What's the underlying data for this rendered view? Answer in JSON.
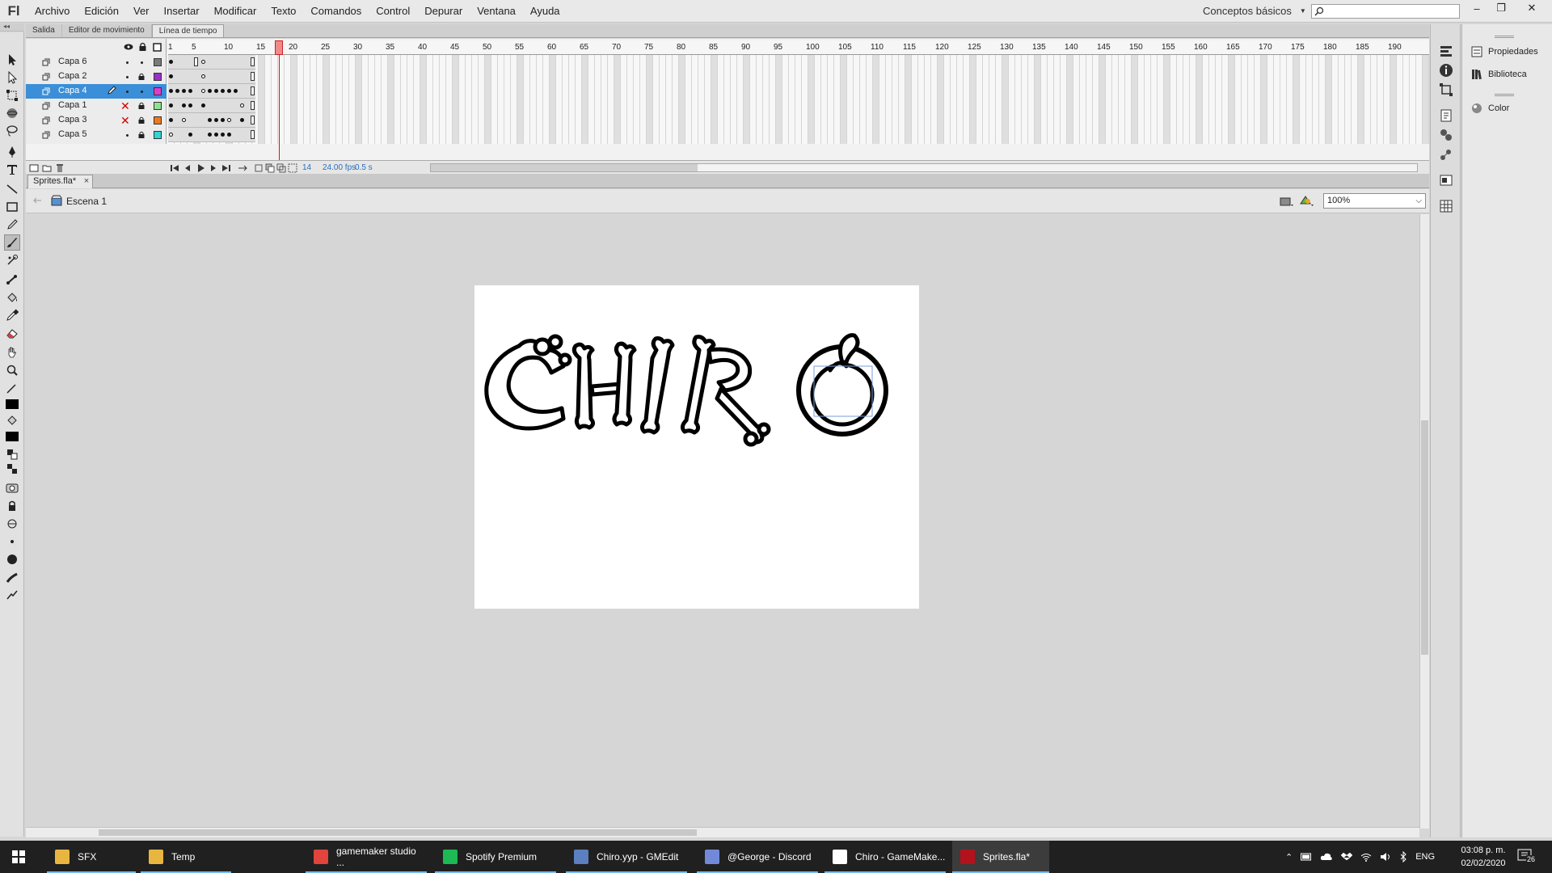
{
  "app": {
    "logo": "Fl"
  },
  "menu": [
    "Archivo",
    "Edición",
    "Ver",
    "Insertar",
    "Modificar",
    "Texto",
    "Comandos",
    "Control",
    "Depurar",
    "Ventana",
    "Ayuda"
  ],
  "workspace": {
    "label": "Conceptos básicos"
  },
  "search": {
    "placeholder": ""
  },
  "window_controls": {
    "minimize": "–",
    "restore": "❐",
    "close": "✕"
  },
  "panel_tabs": [
    {
      "label": "Salida",
      "active": false
    },
    {
      "label": "Editor de movimiento",
      "active": false
    },
    {
      "label": "Línea de tiempo",
      "active": true
    }
  ],
  "timeline": {
    "ruler": [
      "1",
      "5",
      "10",
      "15",
      "20",
      "25",
      "30",
      "35",
      "40",
      "45",
      "50",
      "55",
      "60",
      "65",
      "70",
      "75",
      "80",
      "85",
      "90",
      "95",
      "100",
      "105",
      "110",
      "115",
      "120",
      "125",
      "130",
      "135",
      "140",
      "145",
      "150",
      "155",
      "160",
      "165",
      "170",
      "175",
      "180",
      "185",
      "190"
    ],
    "layers": [
      {
        "name": "Capa 6",
        "color": "#7a7a7a",
        "selected": false,
        "hidden": false,
        "locked": false
      },
      {
        "name": "Capa 2",
        "color": "#9b30c8",
        "selected": false,
        "hidden": false,
        "locked": true
      },
      {
        "name": "Capa 4",
        "color": "#e03ad6",
        "selected": true,
        "hidden": false,
        "locked": false
      },
      {
        "name": "Capa 1",
        "color": "#8fe28f",
        "selected": false,
        "hidden": true,
        "locked": true
      },
      {
        "name": "Capa 3",
        "color": "#f07a1a",
        "selected": false,
        "hidden": true,
        "locked": true
      },
      {
        "name": "Capa 5",
        "color": "#33d4d4",
        "selected": false,
        "hidden": false,
        "locked": true
      }
    ],
    "current_frame": "14",
    "fps": "24.00 fps",
    "time": "0.5 s",
    "playhead_frame": "15"
  },
  "document": {
    "tab": "Sprites.fla*",
    "close": "×",
    "scene": "Escena 1",
    "zoom": "100%"
  },
  "right_panel": {
    "items": [
      "Propiedades",
      "Biblioteca",
      "Color"
    ]
  },
  "taskbar": {
    "items": [
      {
        "label": "SFX",
        "icon": "folder-icon",
        "color": "#e8b640"
      },
      {
        "label": "Temp",
        "icon": "folder-icon",
        "color": "#e8b640"
      },
      {
        "label": "gamemaker studio ...",
        "icon": "chrome-icon",
        "color": "#e0443b"
      },
      {
        "label": "Spotify Premium",
        "icon": "spotify-icon",
        "color": "#1db954"
      },
      {
        "label": "Chiro.yyp - GMEdit",
        "icon": "gmedit-icon",
        "color": "#5b7fbf"
      },
      {
        "label": "@George - Discord",
        "icon": "discord-icon",
        "color": "#7289da"
      },
      {
        "label": "Chiro - GameMake...",
        "icon": "gamemaker-icon",
        "color": "#ffffff"
      },
      {
        "label": "Sprites.fla*",
        "icon": "flash-icon",
        "color": "#b3121c"
      }
    ],
    "lang": "ENG",
    "time": "03:08 p. m.",
    "date": "02/02/2020",
    "notifications": "26"
  }
}
